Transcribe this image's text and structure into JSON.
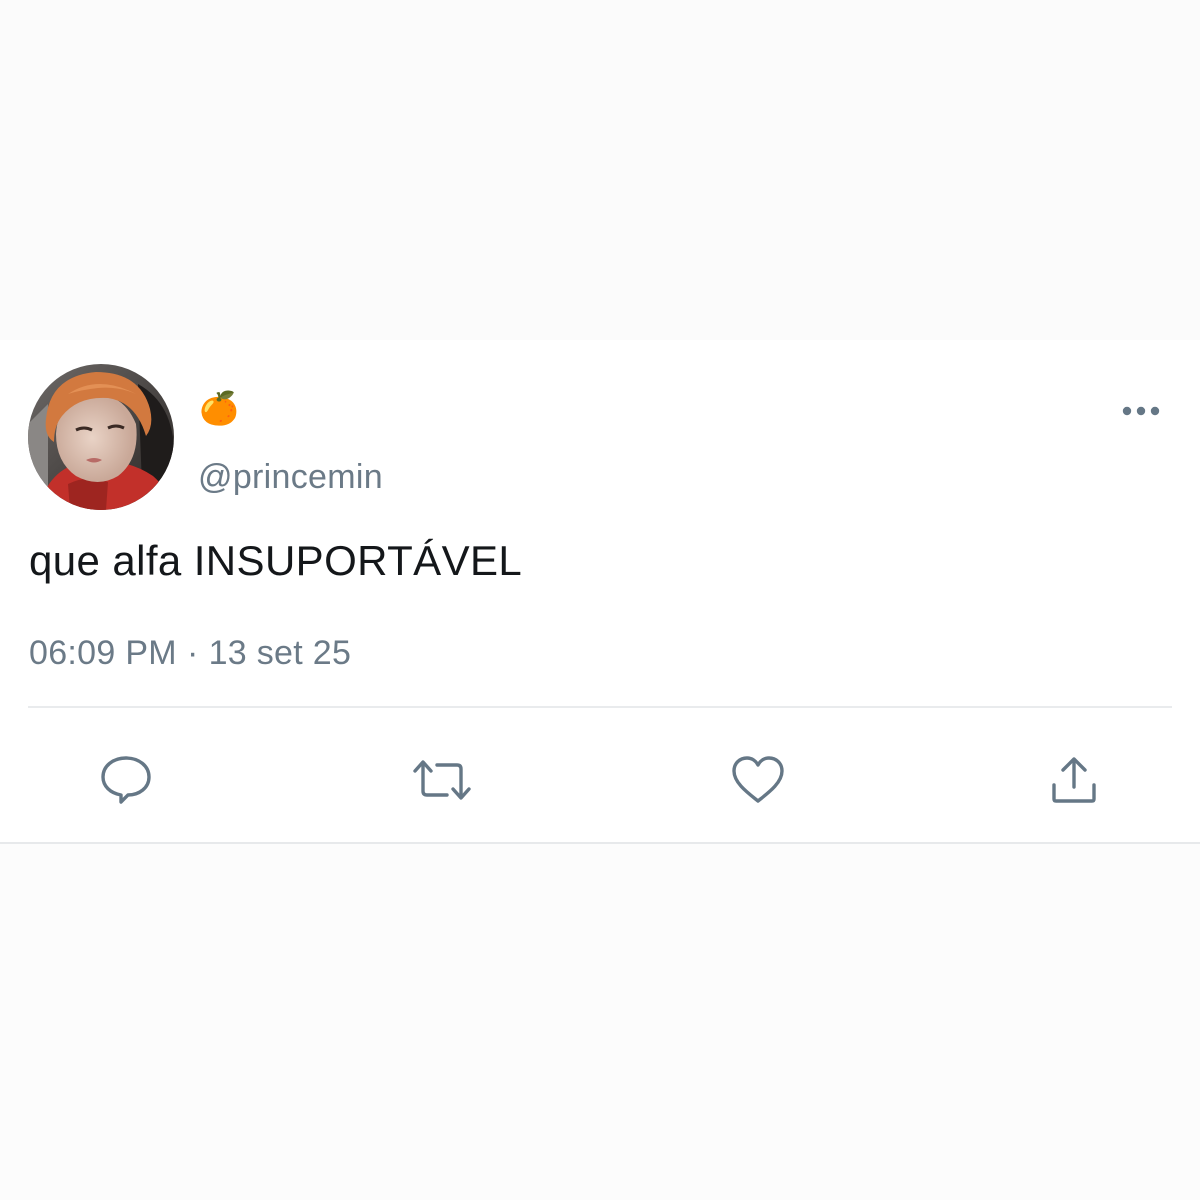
{
  "tweet": {
    "display_name": "🍊",
    "handle": "@princemin",
    "text": "que alfa INSUPORTÁVEL",
    "time": "06:09 PM",
    "separator": "·",
    "date": "13 set 25"
  },
  "icons": {
    "more": "more-horizontal-icon",
    "reply": "reply-bubble-icon",
    "retweet": "retweet-icon",
    "like": "heart-icon",
    "share": "share-upload-icon"
  },
  "colors": {
    "text": "#14171a",
    "secondary": "#6b7a87",
    "icon": "#657786",
    "divider": "#e9ebed"
  }
}
